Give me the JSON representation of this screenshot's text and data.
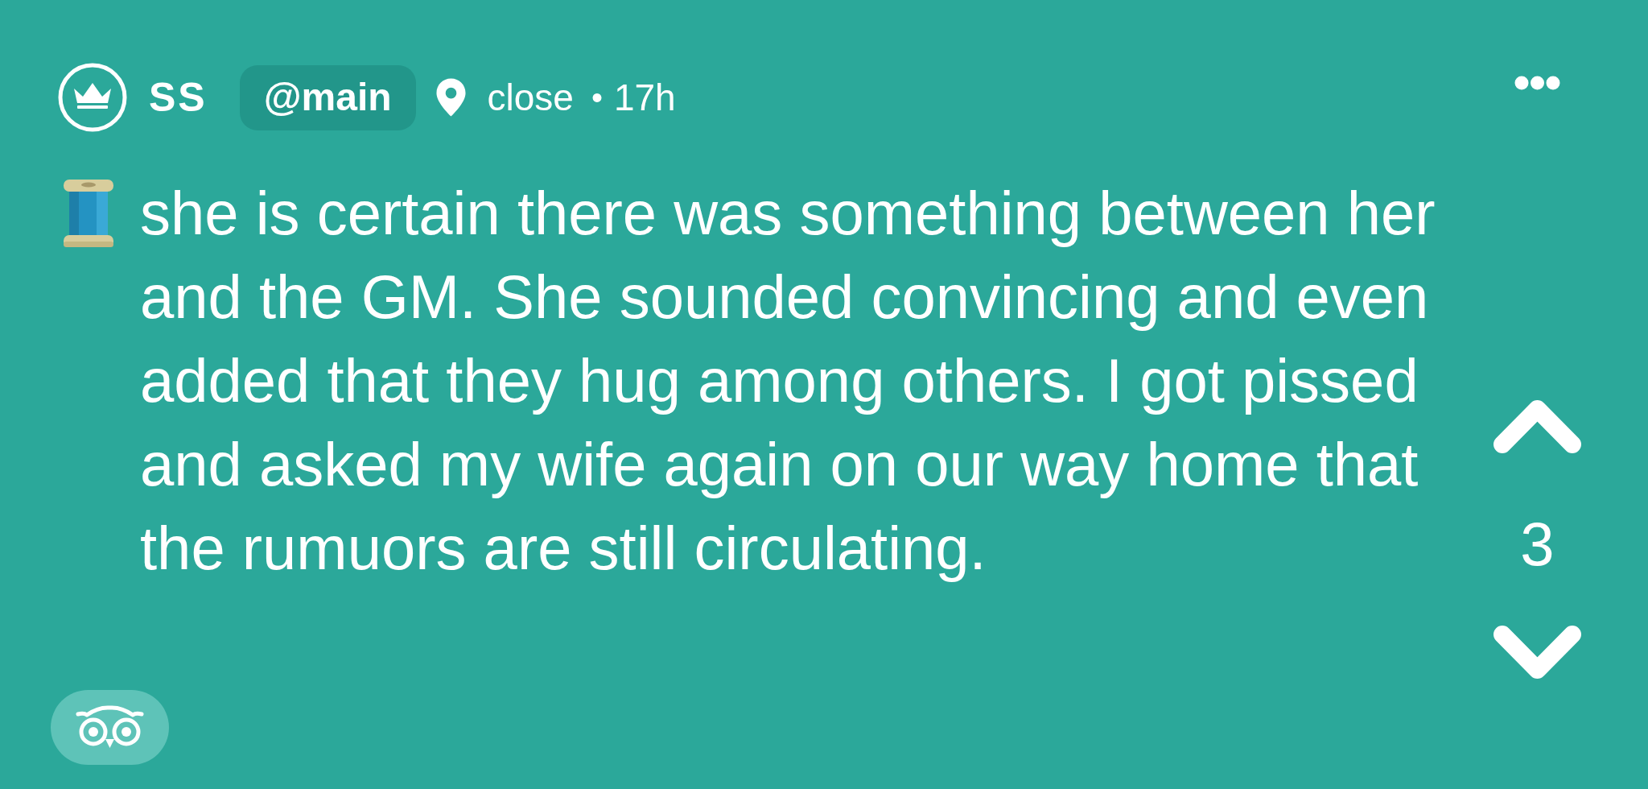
{
  "post": {
    "author": {
      "name": "SS",
      "channel": "@main"
    },
    "location": "close",
    "separator": "•",
    "time": "17h",
    "text": "she is certain there was something between her and the GM. She sounded convincing and even added that they hug among others. I got pissed and asked my wife again on our way home that the rumuors are still circulating."
  },
  "votes": {
    "count": "3"
  }
}
